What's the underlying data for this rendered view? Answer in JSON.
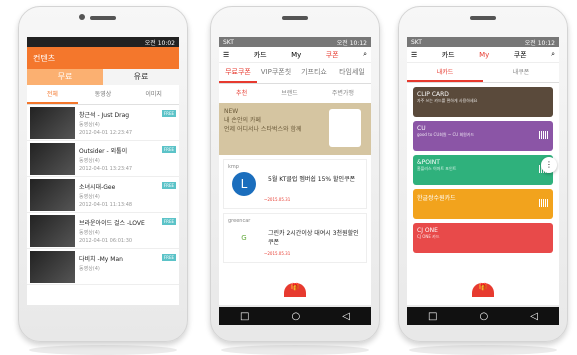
{
  "phone1": {
    "status_time": "오전 10:02",
    "header_title": "컨텐츠",
    "tabs": [
      {
        "label": "무료"
      },
      {
        "label": "유료"
      }
    ],
    "subtabs": [
      {
        "label": "전체"
      },
      {
        "label": "동영상"
      },
      {
        "label": "이미지"
      }
    ],
    "items": [
      {
        "title": "창근석 - Just Drag",
        "sub": "동영상(4)",
        "date": "2012-04-01 12:23:47",
        "badge": "FREE"
      },
      {
        "title": "Outsider - 외톨이",
        "sub": "동영상(4)",
        "date": "2012-04-01 13:23:47",
        "badge": "FREE"
      },
      {
        "title": "소녀시대-Gee",
        "sub": "동영상(4)",
        "date": "2012-04-01 11:13:48",
        "badge": "FREE"
      },
      {
        "title": "브라운아이드 걸스 -LOVE",
        "sub": "동영상(4)",
        "date": "2012-04-01 06:01:30",
        "badge": "FREE"
      },
      {
        "title": "다비치 -My Man",
        "sub": "동영상(4)",
        "date": "",
        "badge": "FREE"
      }
    ]
  },
  "phone2": {
    "status_left": "SKT",
    "status_time": "오전 10:12",
    "header": {
      "card": "카드",
      "my": "My",
      "coupon": "쿠폰"
    },
    "tabs": [
      {
        "label": "무료쿠폰"
      },
      {
        "label": "VIP쿠폰칫"
      },
      {
        "label": "기프티쇼"
      },
      {
        "label": "타임세일"
      }
    ],
    "filters": [
      {
        "label": "추천"
      },
      {
        "label": "브랜드"
      },
      {
        "label": "주변가맹"
      }
    ],
    "banner": {
      "tag": "NEW",
      "title": "내 손안의 카페",
      "sub": "언제 어디서나 스타벅스와 함께"
    },
    "cards": [
      {
        "brand": "kmp",
        "title": "5월 KT클럽 멤버쉽 15% 할인쿠폰",
        "expire": "~2015.05.31"
      },
      {
        "brand": "greencar",
        "title": "그린카 2시간이상 대여시 3천원할인 쿠폰",
        "expire": "~2015.05.31"
      }
    ]
  },
  "phone3": {
    "status_left": "SKT",
    "status_time": "오전 10:12",
    "header": {
      "card": "카드",
      "my": "My",
      "coupon": "쿠폰"
    },
    "subtabs": [
      {
        "label": "내카드"
      },
      {
        "label": "내쿠폰"
      }
    ],
    "cards": [
      {
        "name": "CLIP CARD",
        "sub": "자주 쓰는 카드를 편하게 사용하세요",
        "color": "#5a4a3b"
      },
      {
        "name": "CU",
        "sub": "good to CU회원 ~ CU 회원카드",
        "color": "#8b55a6"
      },
      {
        "name": "&POINT",
        "sub": "홈플러스 이마트 포인트",
        "color": "#2fb17c"
      },
      {
        "name": "한글쌍수원카드",
        "sub": "",
        "color": "#f2a31d"
      },
      {
        "name": "CJ ONE",
        "sub": "CJ ONE 카드",
        "color": "#e84a4a"
      }
    ]
  },
  "colors": {
    "accent": "#e73a2f",
    "orange": "#f4772c"
  }
}
